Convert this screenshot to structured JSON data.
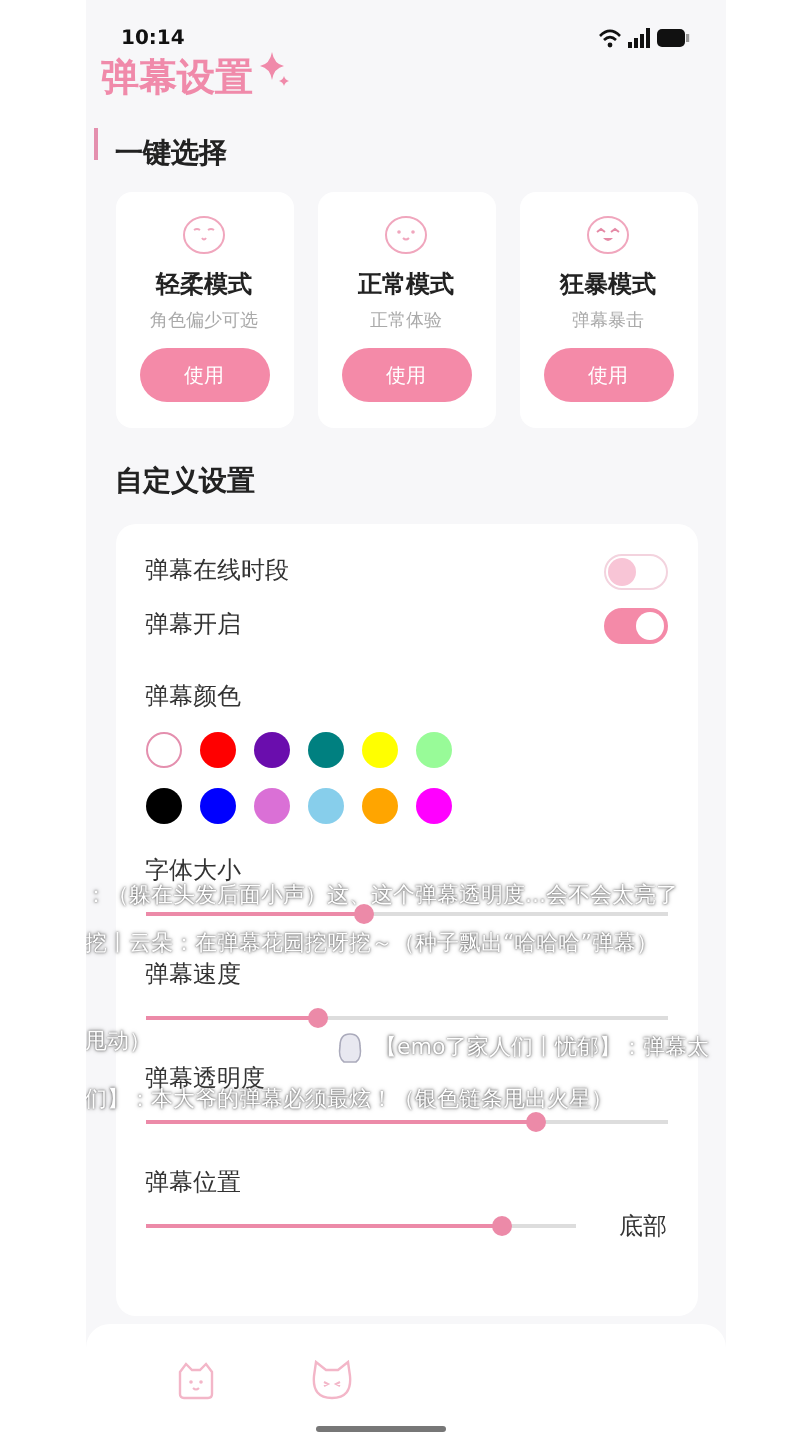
{
  "status_bar": {
    "time": "10:14"
  },
  "header": {
    "title": "弹幕设置"
  },
  "quick_select": {
    "heading": "一键选择",
    "modes": [
      {
        "kind": "calm",
        "title": "轻柔模式",
        "subtitle": "角色偏少可选",
        "button": "使用"
      },
      {
        "kind": "happy",
        "title": "正常模式",
        "subtitle": "正常体验",
        "button": "使用"
      },
      {
        "kind": "excited",
        "title": "狂暴模式",
        "subtitle": "弹幕暴击",
        "button": "使用"
      }
    ]
  },
  "custom": {
    "heading": "自定义设置",
    "toggles": [
      {
        "label": "弹幕在线时段",
        "on": false
      },
      {
        "label": "弹幕开启",
        "on": true
      }
    ],
    "color_label": "弹幕颜色",
    "colors": [
      {
        "color": "#ffffff",
        "selected": true
      },
      {
        "color": "#ff0000",
        "selected": false
      },
      {
        "color": "#6a0dad",
        "selected": false
      },
      {
        "color": "#008080",
        "selected": false
      },
      {
        "color": "#ffff00",
        "selected": false
      },
      {
        "color": "#98fb98",
        "selected": false
      },
      {
        "color": "#000000",
        "selected": false
      },
      {
        "color": "#0000ff",
        "selected": false
      },
      {
        "color": "#da70d6",
        "selected": false
      },
      {
        "color": "#87ceeb",
        "selected": false
      },
      {
        "color": "#ffa500",
        "selected": false
      },
      {
        "color": "#ff00ff",
        "selected": false
      }
    ],
    "sliders": [
      {
        "label": "字体大小",
        "level": 0.42
      },
      {
        "label": "弹幕速度",
        "level": 0.33
      },
      {
        "label": "弹幕透明度",
        "level": 0.75
      },
      {
        "label": "弹幕位置",
        "level": 0.83,
        "reading": "底部"
      }
    ]
  },
  "danmaku": [
    {
      "text": "：（躲在头发后面小声）这、这个弹幕透明度...会不会太亮了",
      "avatar": false
    },
    {
      "text": "挖丨云朵：在弹幕花园挖呀挖～（种子飘出“哈哈哈”弹幕）",
      "avatar": false
    },
    {
      "text": "甩动）",
      "avatar": false
    },
    {
      "text": "【emo了家人们丨忧郁】：弹幕太",
      "avatar": true
    },
    {
      "text": "们】：本大爷的弹幕必须最炫！（银色链条甩出火星）",
      "avatar": false
    }
  ]
}
